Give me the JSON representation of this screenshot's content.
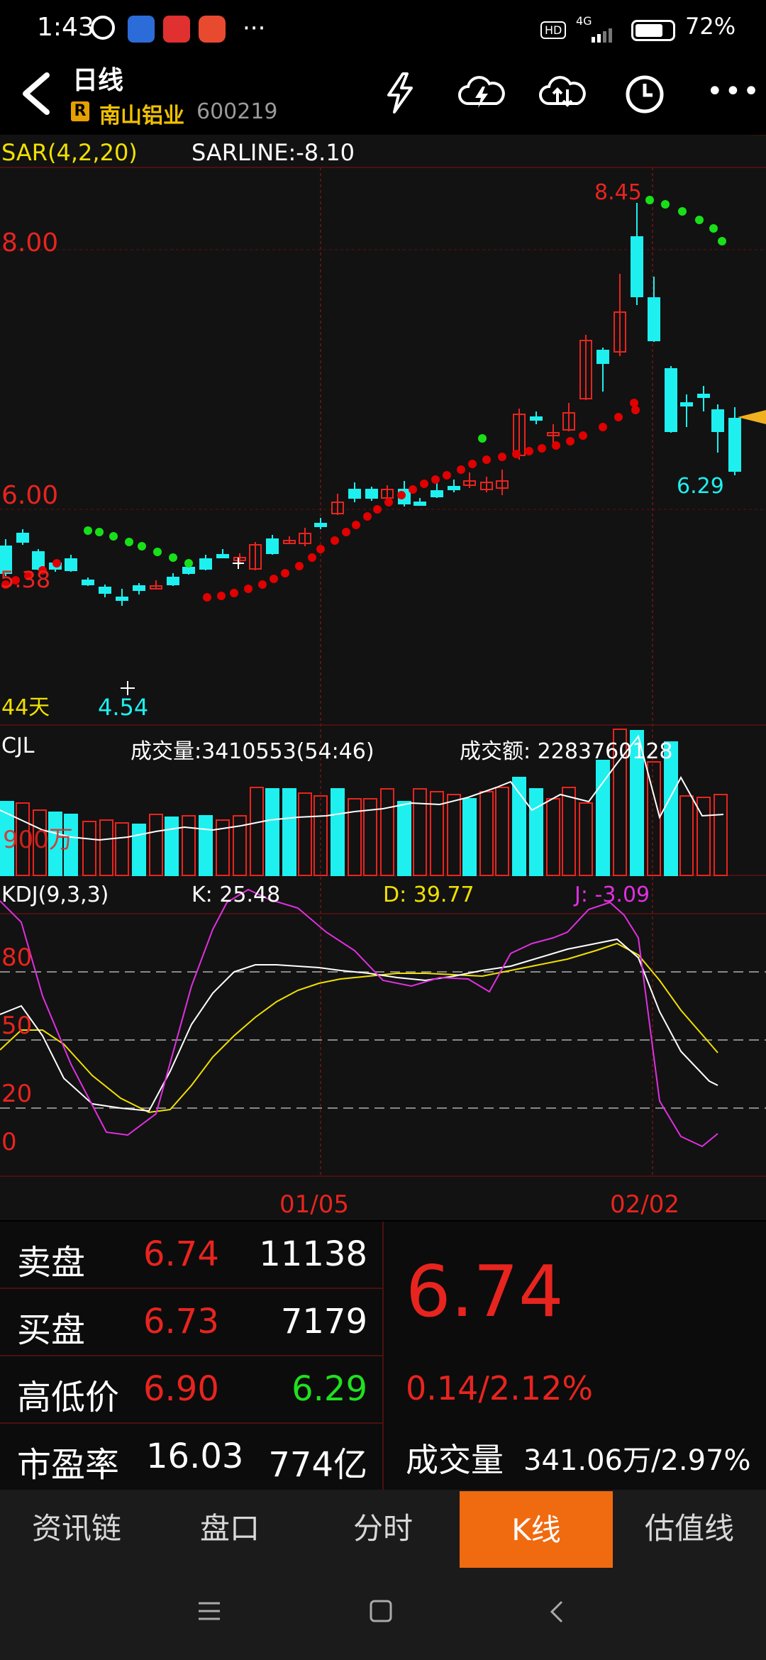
{
  "status_bar": {
    "time": "1:43",
    "network": "4G",
    "battery": "72%",
    "hd": "HD"
  },
  "header": {
    "title": "日线",
    "badge": "R",
    "stock_name": "南山铝业",
    "stock_code": "600219"
  },
  "indicator_sar": {
    "label": "SAR(4,2,20)",
    "sarline": "SARLINE:-8.10"
  },
  "price_chart": {
    "y_labels": [
      "8.00",
      "6.00",
      "5.38"
    ],
    "high_label": "8.45",
    "low_label": "4.54",
    "last_low_label": "6.29",
    "days_label": "44天"
  },
  "volume_panel": {
    "label": "CJL",
    "volume_text": "成交量:3410553(54:46)",
    "amount_text": "成交额: 2283760128",
    "scale_label": "900万"
  },
  "kdj_panel": {
    "label": "KDJ(9,3,3)",
    "k": "K: 25.48",
    "d": "D: 39.77",
    "j": "J: -3.09",
    "levels": [
      "80",
      "50",
      "20",
      "0"
    ]
  },
  "x_axis": {
    "dates": [
      "01/05",
      "02/02"
    ]
  },
  "quote": {
    "sell_label": "卖盘",
    "sell_price": "6.74",
    "sell_vol": "11138",
    "buy_label": "买盘",
    "buy_price": "6.73",
    "buy_vol": "7179",
    "hl_label": "高低价",
    "high": "6.90",
    "low": "6.29",
    "pe_label": "市盈率",
    "pe": "16.03",
    "mcap": "774亿",
    "last_price": "6.74",
    "change": "0.14/2.12%",
    "vol_label": "成交量",
    "vol_value": "341.06万/2.97%"
  },
  "tabs": [
    "资讯链",
    "盘口",
    "分时",
    "K线",
    "估值线"
  ],
  "colors": {
    "up": "#e8241e",
    "down": "#1ef0f0",
    "sar_up": "#e00000",
    "sar_down": "#18e018",
    "accent": "#f06a0f"
  }
}
